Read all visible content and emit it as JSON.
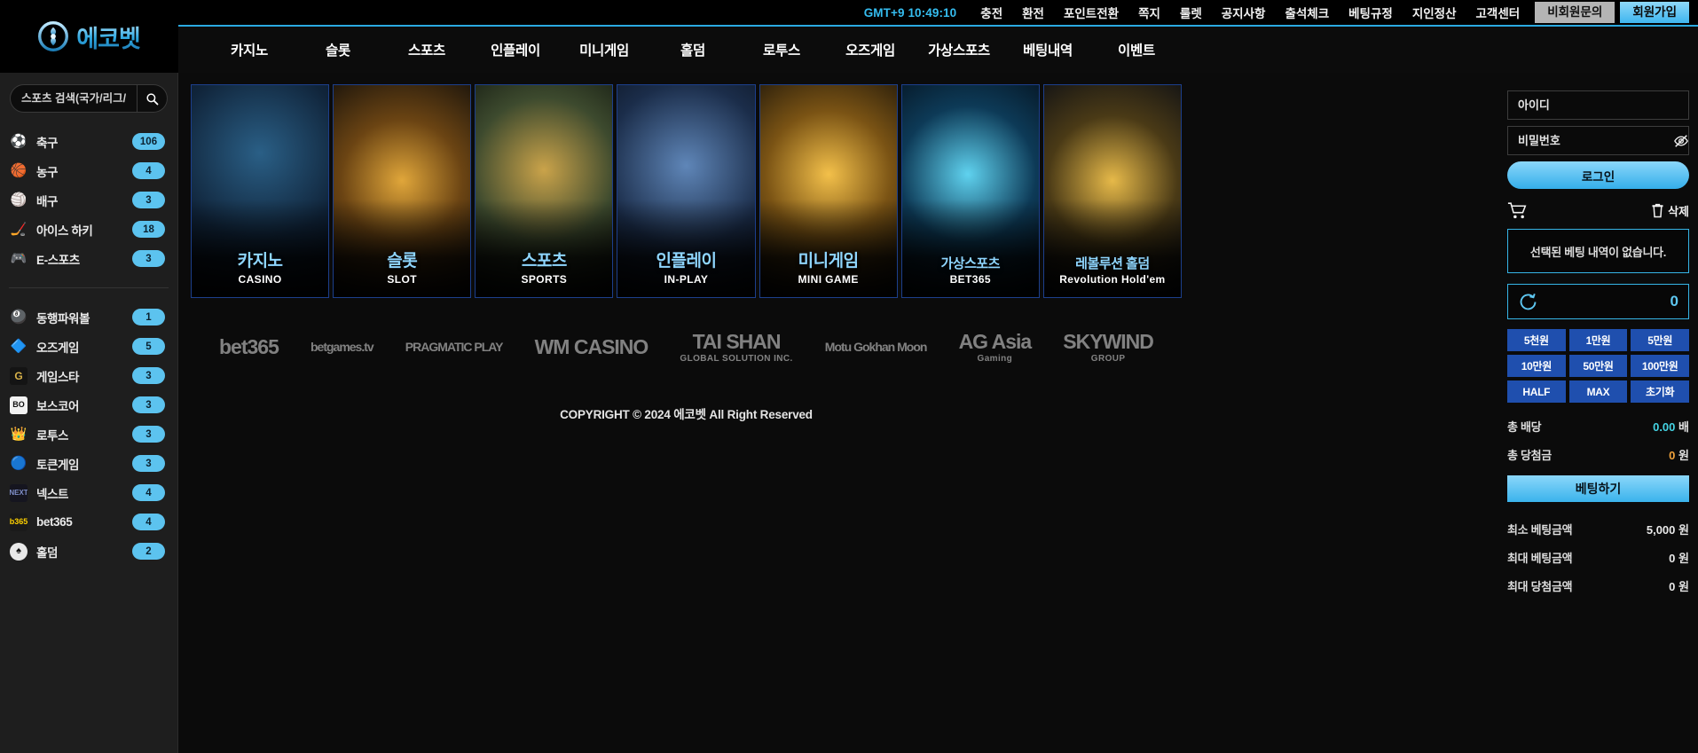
{
  "brand": {
    "name": "에코벳"
  },
  "topbar": {
    "clock": "GMT+9 10:49:10",
    "links": [
      "충전",
      "환전",
      "포인트전환",
      "쪽지",
      "룰렛",
      "공지사항",
      "출석체크",
      "베팅규정",
      "지인정산",
      "고객센터"
    ],
    "guest_button": "비회원문의",
    "join_button": "회원가입"
  },
  "nav": {
    "items": [
      "카지노",
      "슬롯",
      "스포츠",
      "인플레이",
      "미니게임",
      "홀덤",
      "로투스",
      "오즈게임",
      "가상스포츠",
      "베팅내역",
      "이벤트"
    ]
  },
  "sidebar": {
    "search_placeholder": "스포츠 검색(국가/리그/팀명)",
    "search_value": "",
    "sports": [
      {
        "icon": "soccer-ball",
        "glyph": "⚽",
        "label": "축구",
        "count": "106"
      },
      {
        "icon": "basketball",
        "glyph": "🏀",
        "label": "농구",
        "count": "4"
      },
      {
        "icon": "volleyball",
        "glyph": "🏐",
        "label": "배구",
        "count": "3"
      },
      {
        "icon": "ice-hockey",
        "glyph": "🏒",
        "label": "아이스 하키",
        "count": "18"
      },
      {
        "icon": "esports",
        "glyph": "🎮",
        "label": "E-스포츠",
        "count": "3"
      }
    ],
    "games": [
      {
        "icon": "powerball",
        "glyph": "🎱",
        "label": "동행파워볼",
        "count": "1"
      },
      {
        "icon": "odds-game",
        "glyph": "🔷",
        "label": "오즈게임",
        "count": "5"
      },
      {
        "icon": "gamestar",
        "glyph": "🅖",
        "label": "게임스타",
        "count": "3"
      },
      {
        "icon": "bosscore",
        "glyph": "🅑",
        "label": "보스코어",
        "count": "3"
      },
      {
        "icon": "lotus",
        "glyph": "👑",
        "label": "로투스",
        "count": "3"
      },
      {
        "icon": "token-game",
        "glyph": "🔵",
        "label": "토큰게임",
        "count": "3"
      },
      {
        "icon": "next",
        "glyph": "N",
        "label": "넥스트",
        "count": "4"
      },
      {
        "icon": "bet365",
        "glyph": "b",
        "label": "bet365",
        "count": "4"
      },
      {
        "icon": "holdem",
        "glyph": "♠",
        "label": "홀덤",
        "count": "2"
      }
    ]
  },
  "main": {
    "cards": [
      {
        "kr": "카지노",
        "en": "CASINO",
        "art": "casino-woman"
      },
      {
        "kr": "슬롯",
        "en": "SLOT",
        "art": "slot-machine"
      },
      {
        "kr": "스포츠",
        "en": "SPORTS",
        "art": "golden-trophy"
      },
      {
        "kr": "인플레이",
        "en": "IN-PLAY",
        "art": "baseball-player"
      },
      {
        "kr": "미니게임",
        "en": "MINI GAME",
        "art": "golden-dice"
      },
      {
        "kr": "가상스포츠",
        "en": "BET365",
        "art": "blue-horse"
      },
      {
        "kr": "레볼루션 홀덤",
        "en": "Revolution Hold'em",
        "art": "playing-cards"
      }
    ],
    "partners": [
      {
        "line1": "bet365",
        "line2": ""
      },
      {
        "line1": "betgames.tv",
        "line2": ""
      },
      {
        "line1": "PRAGMATIC PLAY",
        "line2": ""
      },
      {
        "line1": "WM CASINO",
        "line2": ""
      },
      {
        "line1": "TAI SHAN",
        "line2": "GLOBAL SOLUTION INC."
      },
      {
        "line1": "Motu Gokhan Moon",
        "line2": ""
      },
      {
        "line1": "AG Asia",
        "line2": "Gaming"
      },
      {
        "line1": "SKYWIND",
        "line2": "GROUP"
      }
    ],
    "copyright": "COPYRIGHT © 2024 에코벳 All Right Reserved"
  },
  "betslip": {
    "id_placeholder": "아이디",
    "id_value": "",
    "pw_placeholder": "비밀번호",
    "pw_value": "",
    "login_button": "로그인",
    "delete_label": "삭제",
    "empty_message": "선택된 베팅 내역이 없습니다.",
    "amount_value": "0",
    "chips": [
      "5천원",
      "1만원",
      "5만원",
      "10만원",
      "50만원",
      "100만원",
      "HALF",
      "MAX",
      "초기화"
    ],
    "total_odds_label": "총 배당",
    "total_odds_value": "0.00",
    "total_odds_unit": "배",
    "total_win_label": "총 당첨금",
    "total_win_value": "0",
    "total_win_unit": "원",
    "bet_button": "베팅하기",
    "limits": [
      {
        "label": "최소 베팅금액",
        "value": "5,000",
        "unit": "원"
      },
      {
        "label": "최대 베팅금액",
        "value": "0",
        "unit": "원"
      },
      {
        "label": "최대 당첨금액",
        "value": "0",
        "unit": "원"
      }
    ]
  },
  "colors": {
    "accent_cyan": "#36b5e6",
    "chip_blue": "#1f4fae",
    "badge": "#5cc3ef",
    "odds_cyan": "#44d4e4",
    "win_orange": "#f0a23b"
  }
}
